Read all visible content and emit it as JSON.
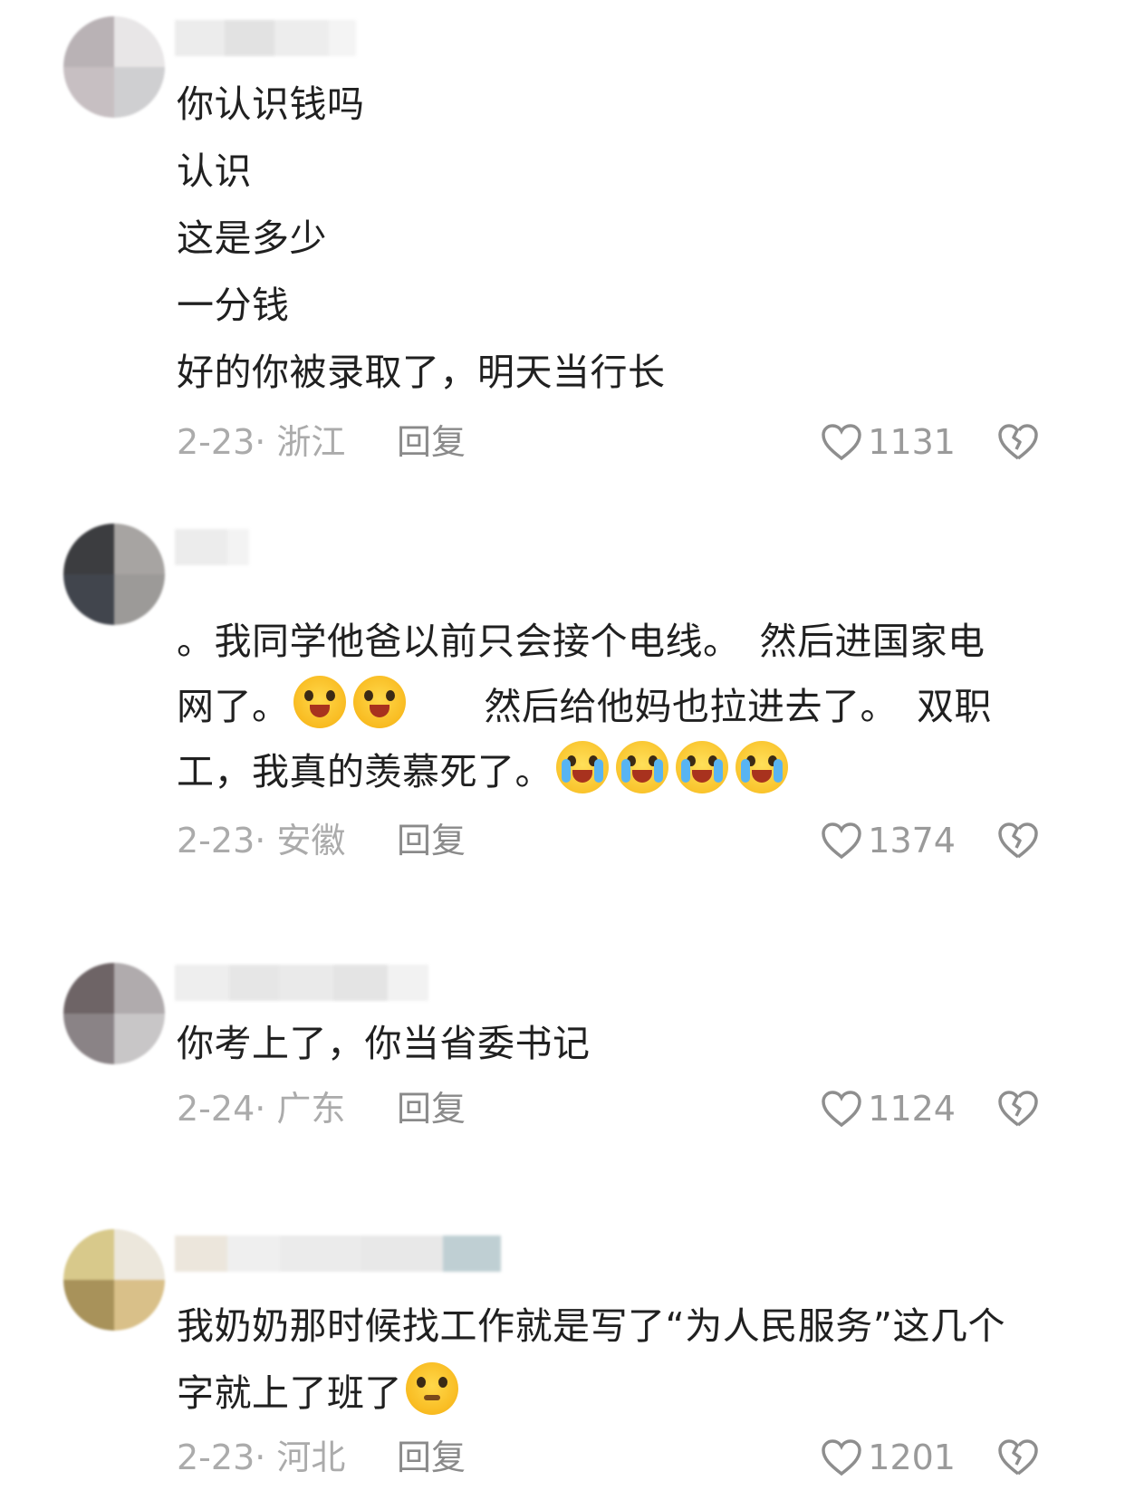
{
  "comments": [
    {
      "lines": [
        "你认识钱吗",
        "认识",
        "这是多少",
        "一分钱",
        "好的你被录取了，明天当行长"
      ],
      "date": "2-23",
      "location": "浙江",
      "reply_label": "回复",
      "likes": "1131",
      "colors": {
        "avatar": [
          "#b9b2b5",
          "#e8e6e7",
          "#c7bfc2",
          "#cfcfd1"
        ]
      }
    },
    {
      "line1": "。我同学他爸以前只会接个电线。　然后进国家电",
      "line2_a": "网了。",
      "line2_b": "　　然后给他妈也拉进去了。　双职",
      "line3": "工，我真的羡慕死了。",
      "emoji_names": [
        "laughing-tears-emoji",
        "crying-emoji"
      ],
      "date": "2-23",
      "location": "安徽",
      "reply_label": "回复",
      "likes": "1374",
      "colors": {
        "avatar": [
          "#3c3d40",
          "#a7a4a2",
          "#41454d",
          "#9c9a98"
        ]
      }
    },
    {
      "lines": [
        "你考上了，你当省委书记"
      ],
      "date": "2-24",
      "location": "广东",
      "reply_label": "回复",
      "likes": "1124",
      "colors": {
        "avatar": [
          "#6e6466",
          "#b0abad",
          "#8a8386",
          "#c8c6c7"
        ]
      }
    },
    {
      "line1": "我奶奶那时候找工作就是写了“为人民服务”这几个",
      "line2": "字就上了班了",
      "emoji_names": [
        "thinking-emoji"
      ],
      "date": "2-23",
      "location": "河北",
      "reply_label": "回复",
      "likes": "1201",
      "colors": {
        "avatar": [
          "#d8c98b",
          "#ece7dc",
          "#a8925a",
          "#d9c089"
        ]
      }
    }
  ]
}
